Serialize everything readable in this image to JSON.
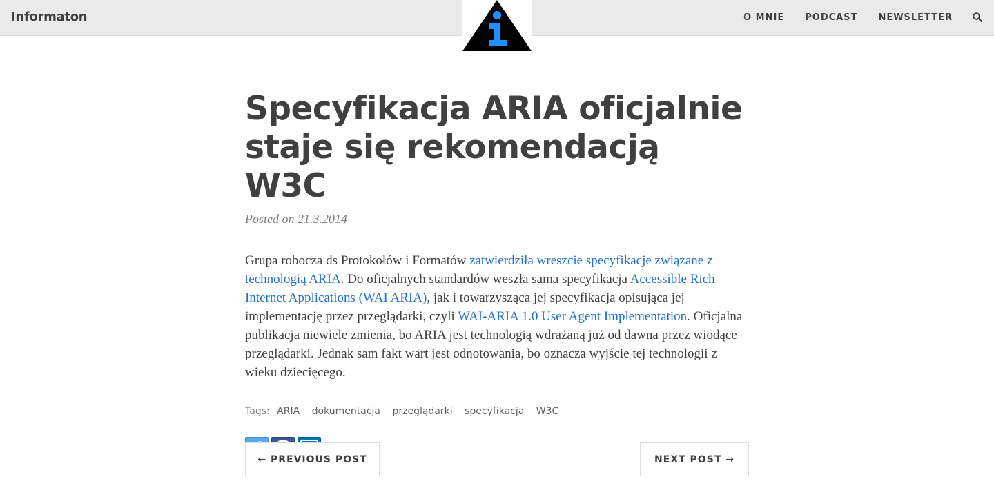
{
  "navbar": {
    "brand": "Informaton",
    "links": [
      "O MNIE",
      "PODCAST",
      "NEWSLETTER"
    ],
    "search_icon": "search-icon"
  },
  "logo": {
    "icon": "info-triangle-logo",
    "colors": {
      "triangle": "#000000",
      "letter": "#1e90ff"
    }
  },
  "post": {
    "title": "Specyfikacja ARIA oficjalnie staje się rekomendacją W3C",
    "meta": "Posted on 21.3.2014",
    "body": {
      "t1": "Grupa robocza ds Protokołów i Formatów ",
      "l1": "zatwierdziła wreszcie specyfikacje związane z technologią ARIA.",
      "t2": " Do oficjalnych standardów weszła sama specyfikacja ",
      "l2": "Accessible Rich Internet Applications (WAI ARIA)",
      "t3": ", jak i towarzysząca jej specyfikacja opisująca jej implementację przez przeglądarki, czyli ",
      "l3": "WAI-ARIA 1.0 User Agent Implementation",
      "t4": ". Oficjalna publikacja niewiele zmienia, bo ARIA jest technologią wdrażaną już od dawna przez wiodące przeglądarki. Jednak sam fakt wart jest odnotowania, bo oznacza wyjście tej technologii z wieku dziecięcego."
    },
    "tags_label": "Tags:",
    "tags": [
      "ARIA",
      "dokumentacja",
      "przeglądarki",
      "specyfikacja",
      "W3C"
    ],
    "share": [
      "twitter-icon",
      "facebook-icon",
      "linkedin-icon"
    ]
  },
  "pager": {
    "prev": "← PREVIOUS POST",
    "next": "NEXT POST →"
  },
  "colors": {
    "link": "#2472c8",
    "navbar_bg": "#eaeaea",
    "text": "#404040"
  }
}
